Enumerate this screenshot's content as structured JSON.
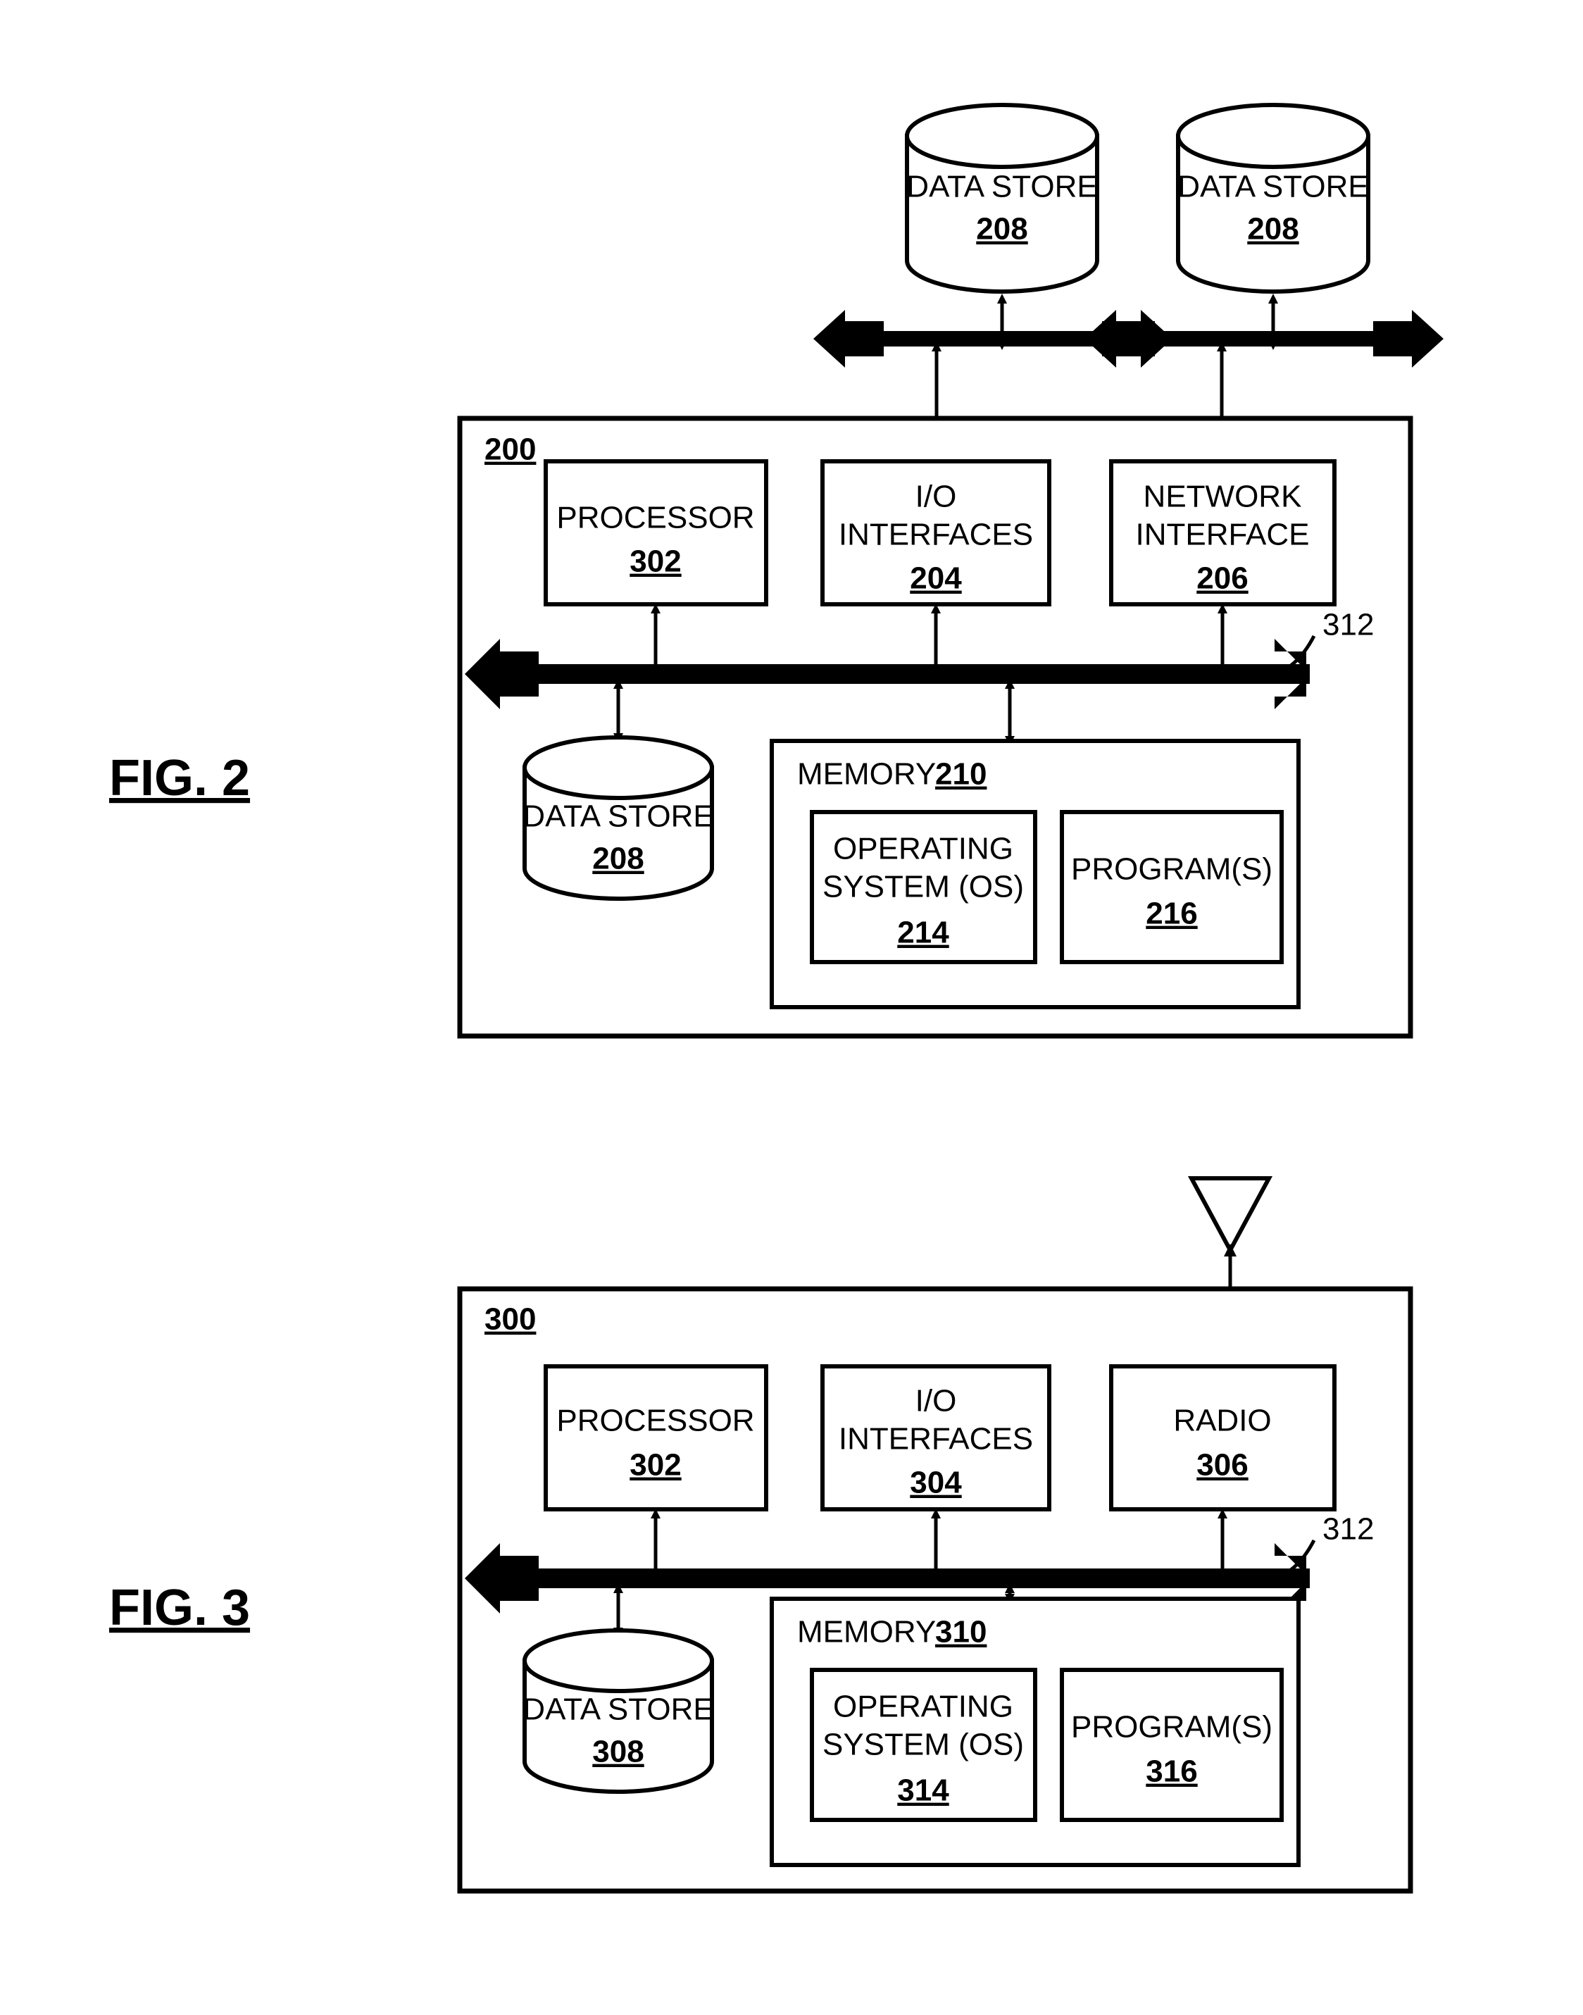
{
  "document": {
    "type": "patent-drawing-sheet",
    "figures": [
      {
        "caption": "FIG. 2",
        "system_ref": "200",
        "bus_ref": "312",
        "external_data_stores": [
          {
            "label": "DATA STORE",
            "ref": "208"
          },
          {
            "label": "DATA STORE",
            "ref": "208"
          }
        ],
        "top_blocks": [
          {
            "label_lines": [
              "PROCESSOR"
            ],
            "ref": "302"
          },
          {
            "label_lines": [
              "I/O",
              "INTERFACES"
            ],
            "ref": "204"
          },
          {
            "label_lines": [
              "NETWORK",
              "INTERFACE"
            ],
            "ref": "206"
          }
        ],
        "internal_data_store": {
          "label": "DATA STORE",
          "ref": "208"
        },
        "memory": {
          "label": "MEMORY",
          "ref": "210",
          "blocks": [
            {
              "label_lines": [
                "OPERATING",
                "SYSTEM (OS)"
              ],
              "ref": "214"
            },
            {
              "label_lines": [
                "PROGRAM(S)"
              ],
              "ref": "216"
            }
          ]
        }
      },
      {
        "caption": "FIG. 3",
        "system_ref": "300",
        "bus_ref": "312",
        "antenna": "antenna-symbol",
        "top_blocks": [
          {
            "label_lines": [
              "PROCESSOR"
            ],
            "ref": "302"
          },
          {
            "label_lines": [
              "I/O",
              "INTERFACES"
            ],
            "ref": "304"
          },
          {
            "label_lines": [
              "RADIO"
            ],
            "ref": "306"
          }
        ],
        "internal_data_store": {
          "label": "DATA STORE",
          "ref": "308"
        },
        "memory": {
          "label": "MEMORY",
          "ref": "310",
          "blocks": [
            {
              "label_lines": [
                "OPERATING",
                "SYSTEM (OS)"
              ],
              "ref": "314"
            },
            {
              "label_lines": [
                "PROGRAM(S)"
              ],
              "ref": "316"
            }
          ]
        }
      }
    ],
    "colors": {
      "ink": "#000000",
      "paper": "#ffffff"
    }
  }
}
